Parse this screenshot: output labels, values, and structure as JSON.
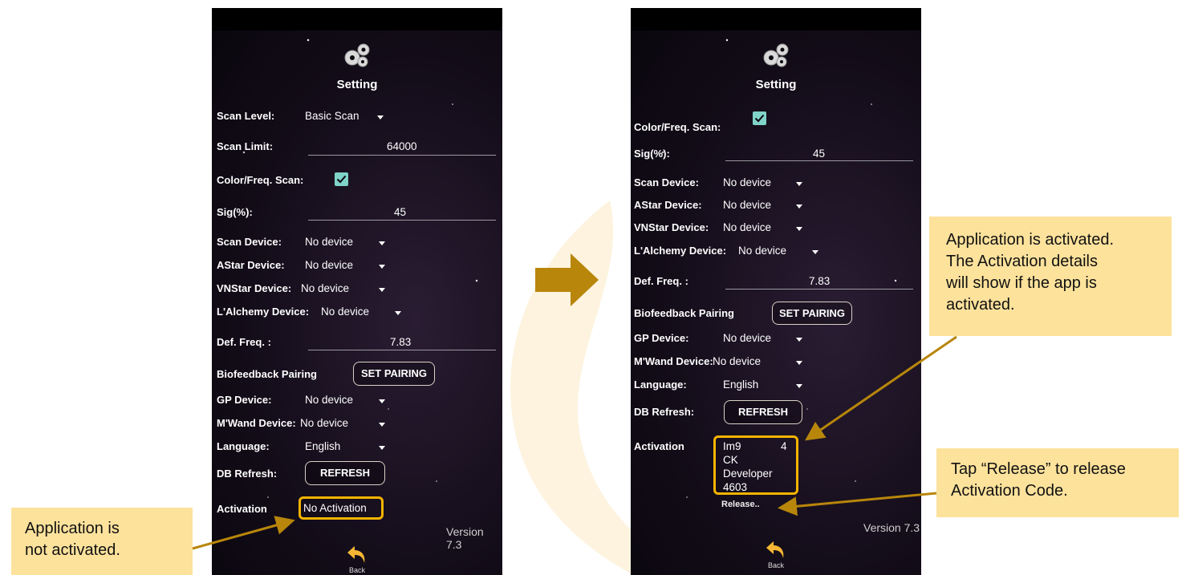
{
  "colors": {
    "accent": "#f5b400",
    "callout_bg": "#fde29c",
    "arrow": "#b8860b",
    "checkbox": "#7fd3c8"
  },
  "left_screen": {
    "title": "Setting",
    "scan_level": {
      "label": "Scan Level:",
      "value": "Basic Scan"
    },
    "scan_limit": {
      "label": "Scan Limit:",
      "value": "64000"
    },
    "color_freq_scan": {
      "label": "Color/Freq. Scan:",
      "checked": true
    },
    "sig": {
      "label": "Sig(%):",
      "value": "45"
    },
    "scan_device": {
      "label": "Scan Device:",
      "value": "No device"
    },
    "astar_device": {
      "label": "AStar Device:",
      "value": "No device"
    },
    "vnstar_device": {
      "label": "VNStar Device:",
      "value": "No device"
    },
    "lalchemy_device": {
      "label": "L'Alchemy Device:",
      "value": "No device"
    },
    "def_freq": {
      "label": "Def. Freq. :",
      "value": "7.83"
    },
    "biofeedback": {
      "label": "Biofeedback Pairing",
      "button": "SET PAIRING"
    },
    "gp_device": {
      "label": "GP Device:",
      "value": "No device"
    },
    "mwand_device": {
      "label": "M'Wand Device:",
      "value": "No device"
    },
    "language": {
      "label": "Language:",
      "value": "English"
    },
    "db_refresh": {
      "label": "DB Refresh:",
      "button": "REFRESH"
    },
    "activation": {
      "label": "Activation",
      "value": "No Activation"
    },
    "version": "Version 7.3",
    "back": "Back"
  },
  "right_screen": {
    "title": "Setting",
    "color_freq_scan": {
      "label": "Color/Freq. Scan:",
      "checked": true
    },
    "sig": {
      "label": "Sig(%):",
      "value": "45"
    },
    "scan_device": {
      "label": "Scan Device:",
      "value": "No device"
    },
    "astar_device": {
      "label": "AStar Device:",
      "value": "No device"
    },
    "vnstar_device": {
      "label": "VNStar Device:",
      "value": "No device"
    },
    "lalchemy_device": {
      "label": "L'Alchemy Device:",
      "value": "No device"
    },
    "def_freq": {
      "label": "Def. Freq. :",
      "value": "7.83"
    },
    "biofeedback": {
      "label": "Biofeedback Pairing",
      "button": "SET PAIRING"
    },
    "gp_device": {
      "label": "GP Device:",
      "value": "No device"
    },
    "mwand_device": {
      "label": "M'Wand Device:",
      "value": "No device"
    },
    "language": {
      "label": "Language:",
      "value": "English"
    },
    "db_refresh": {
      "label": "DB Refresh:",
      "button": "REFRESH"
    },
    "activation": {
      "label": "Activation",
      "line1a": "Im9",
      "line1b": "4",
      "line2": "CK",
      "line3": "Developer",
      "line4": "4603"
    },
    "release": "Release..",
    "version": "Version 7.3",
    "back": "Back"
  },
  "callouts": {
    "not_activated": [
      "Application is",
      "not activated."
    ],
    "activated": [
      "Application is activated.",
      "The Activation details",
      "will show if the app is",
      "activated."
    ],
    "release": [
      "Tap “Release” to release",
      "Activation Code."
    ]
  }
}
